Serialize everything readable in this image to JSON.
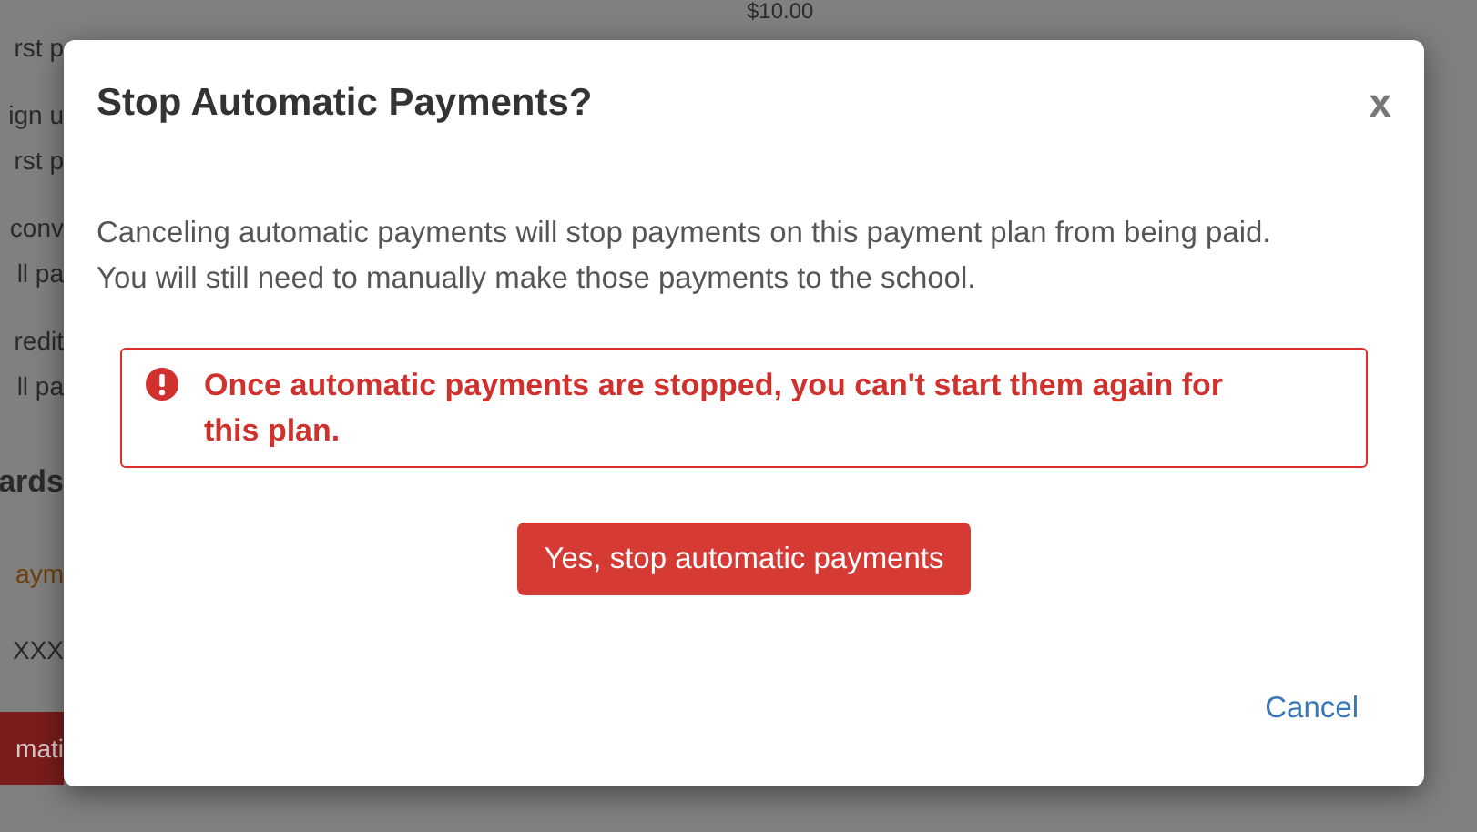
{
  "background": {
    "amount": "$10.00",
    "groups": [
      [
        "rst p"
      ],
      [
        "ign u",
        "rst p"
      ],
      [
        "conv",
        "ll pa"
      ],
      [
        "redit",
        "ll pa"
      ]
    ],
    "heading": "ards",
    "link": "aym",
    "card": "XXX",
    "button": "mati"
  },
  "dialog": {
    "title": "Stop Automatic Payments?",
    "close": "x",
    "message": "Canceling automatic payments will stop payments on this payment plan from being paid. You will still need to manually make those payments to the school.",
    "alert": {
      "text": "Once automatic payments are stopped, you can't start them again for this plan."
    },
    "confirm_button": "Yes, stop automatic payments",
    "cancel_link": "Cancel"
  }
}
